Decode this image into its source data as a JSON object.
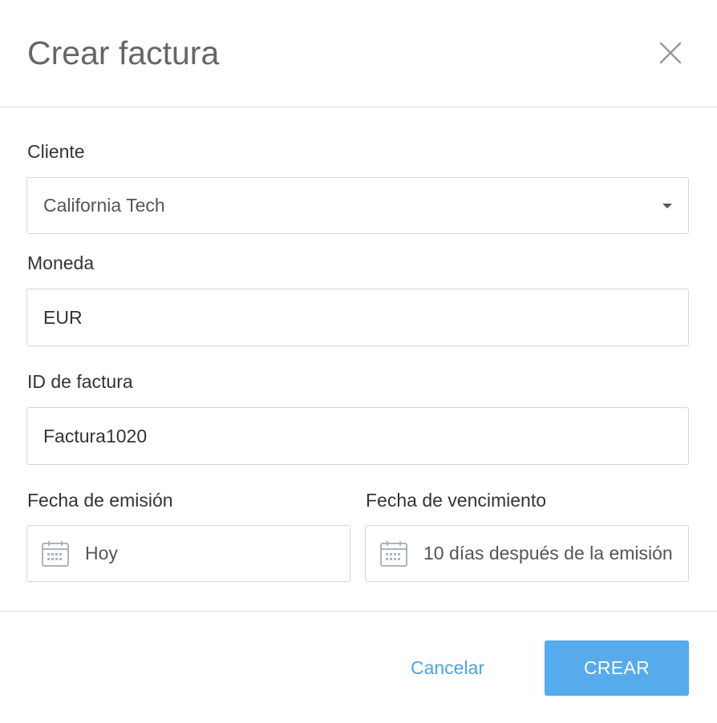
{
  "dialog": {
    "title": "Crear factura",
    "close_icon": "close-icon"
  },
  "form": {
    "client": {
      "label": "Cliente",
      "value": "California Tech",
      "icon": "chevron-down-icon"
    },
    "currency": {
      "label": "Moneda",
      "value": "EUR"
    },
    "invoice_id": {
      "label": "ID de factura",
      "value": "Factura1020"
    },
    "issue_date": {
      "label": "Fecha de emisión",
      "value": "Hoy",
      "icon": "calendar-icon"
    },
    "due_date": {
      "label": "Fecha de vencimiento",
      "value": "10 días después de la emisión",
      "icon": "calendar-icon"
    }
  },
  "footer": {
    "cancel_label": "Cancelar",
    "create_label": "CREAR"
  },
  "colors": {
    "accent": "#4aa3e8",
    "primary_button": "#55abec",
    "border": "#d6d6d6"
  }
}
